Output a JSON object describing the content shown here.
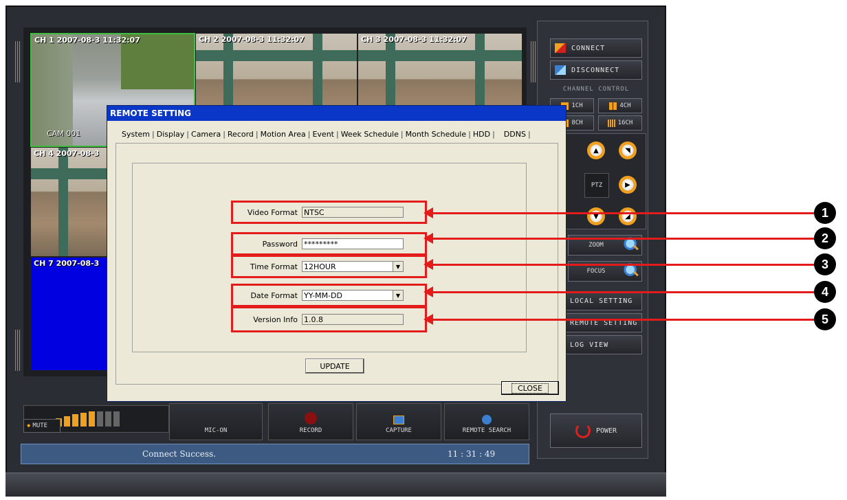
{
  "video": {
    "ch1": "CH 1 2007-08-3 11:32:07",
    "ch2": "CH 2 2007-08-3 11:32:07",
    "ch3": "CH 3 2007-08-3 11:32:07",
    "ch4": "CH 4 2007-08-3",
    "ch7": "CH 7 2007-08-3",
    "cam_tag": "CAM 001"
  },
  "panel": {
    "connect": "CONNECT",
    "disconnect": "DISCONNECT",
    "channel_control": "CHANNEL CONTROL",
    "ch1": "1CH",
    "ch4": "4CH",
    "ch8": "8CH",
    "ch16": "16CH",
    "ptz": "PTZ",
    "zoom": "ZOOM",
    "focus": "FOCUS",
    "local_setting": "LOCAL SETTING",
    "remote_setting": "REMOTE SETTING",
    "log_view": "LOG VIEW",
    "power": "POWER"
  },
  "bottom": {
    "mute": "MUTE",
    "mic": "MIC-ON",
    "record": "RECORD",
    "capture": "CAPTURE",
    "remote_search": "REMOTE SEARCH",
    "status_text": "Connect Success.",
    "time": "11 : 31 : 49"
  },
  "dialog": {
    "title": "REMOTE SETTING",
    "tabs": [
      "System",
      "Display",
      "Camera",
      "Record",
      "Motion Area",
      "Event",
      "Week Schedule",
      "Month Schedule",
      "HDD",
      "DDNS"
    ],
    "fields": {
      "video_format_label": "Video Format",
      "video_format_value": "NTSC",
      "password_label": "Password",
      "password_value": "*********",
      "time_format_label": "Time Format",
      "time_format_value": "12HOUR",
      "date_format_label": "Date Format",
      "date_format_value": "YY-MM-DD",
      "version_label": "Version Info",
      "version_value": "1.0.8"
    },
    "update": "UPDATE",
    "close": "CLOSE"
  },
  "callouts": [
    "1",
    "2",
    "3",
    "4",
    "5"
  ],
  "colors": {
    "callout_red": "#e31b1b",
    "title_blue": "#0a37c8",
    "accent_orange": "#f0a020"
  }
}
